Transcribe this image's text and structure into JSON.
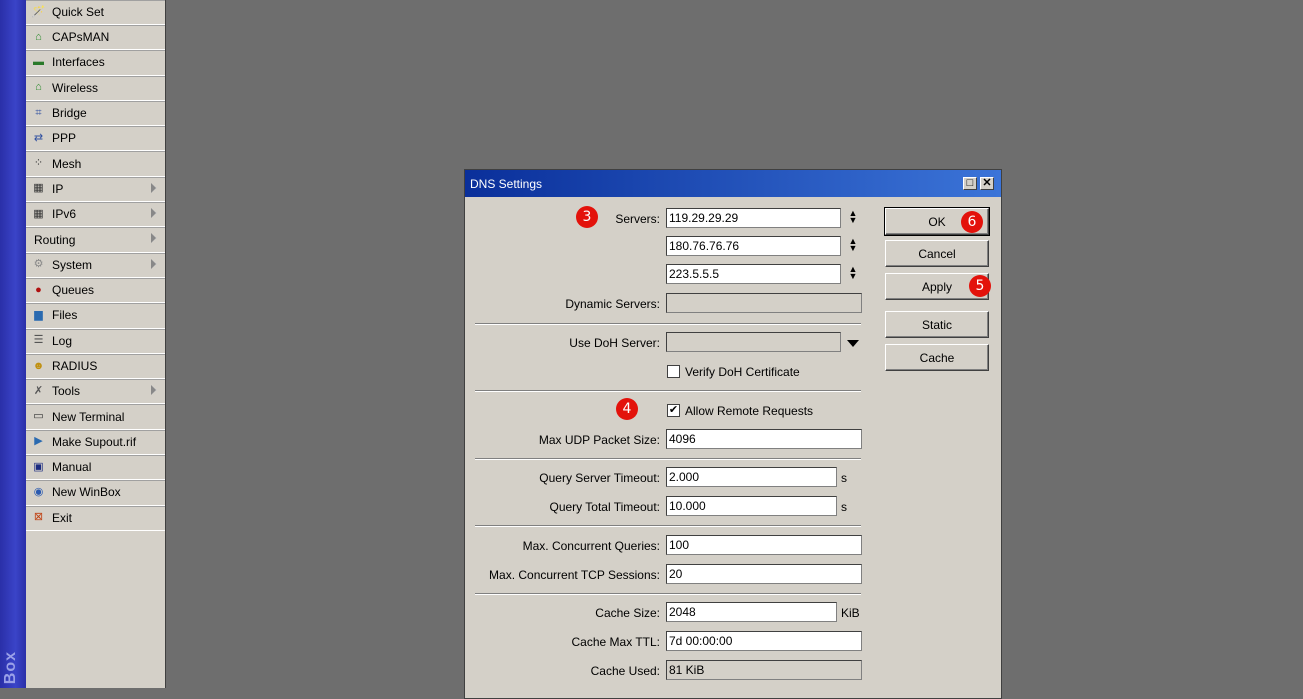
{
  "side_strip": {
    "label": "Box"
  },
  "menu": {
    "items": [
      {
        "label": "Quick Set",
        "icon": "wand-icon",
        "submenu": false
      },
      {
        "label": "CAPsMAN",
        "icon": "antenna-icon",
        "submenu": false
      },
      {
        "label": "Interfaces",
        "icon": "interfaces-icon",
        "submenu": false
      },
      {
        "label": "Wireless",
        "icon": "wireless-icon",
        "submenu": false
      },
      {
        "label": "Bridge",
        "icon": "bridge-icon",
        "submenu": false
      },
      {
        "label": "PPP",
        "icon": "ppp-icon",
        "submenu": false
      },
      {
        "label": "Mesh",
        "icon": "mesh-icon",
        "submenu": false
      },
      {
        "label": "IP",
        "icon": "ip-icon",
        "submenu": true
      },
      {
        "label": "IPv6",
        "icon": "ipv6-icon",
        "submenu": true
      },
      {
        "label": "Routing",
        "icon": "",
        "submenu": true
      },
      {
        "label": "System",
        "icon": "gear-icon",
        "submenu": true
      },
      {
        "label": "Queues",
        "icon": "queues-icon",
        "submenu": false
      },
      {
        "label": "Files",
        "icon": "folder-icon",
        "submenu": false
      },
      {
        "label": "Log",
        "icon": "log-icon",
        "submenu": false
      },
      {
        "label": "RADIUS",
        "icon": "radius-icon",
        "submenu": false
      },
      {
        "label": "Tools",
        "icon": "tools-icon",
        "submenu": true
      },
      {
        "label": "New Terminal",
        "icon": "terminal-icon",
        "submenu": false
      },
      {
        "label": "Make Supout.rif",
        "icon": "supout-icon",
        "submenu": false
      },
      {
        "label": "Manual",
        "icon": "manual-icon",
        "submenu": false
      },
      {
        "label": "New WinBox",
        "icon": "winbox-icon",
        "submenu": false
      },
      {
        "label": "Exit",
        "icon": "exit-icon",
        "submenu": false
      }
    ]
  },
  "dialog": {
    "title": "DNS Settings",
    "servers_label": "Servers:",
    "servers": [
      "119.29.29.29",
      "180.76.76.76",
      "223.5.5.5"
    ],
    "dynamic_servers_label": "Dynamic Servers:",
    "dynamic_servers": "",
    "use_doh_label": "Use DoH Server:",
    "use_doh_value": "",
    "verify_doh_label": "Verify DoH Certificate",
    "verify_doh_checked": false,
    "allow_remote_label": "Allow Remote Requests",
    "allow_remote_checked": true,
    "max_udp_label": "Max UDP Packet Size:",
    "max_udp": "4096",
    "query_server_timeout_label": "Query Server Timeout:",
    "query_server_timeout": "2.000",
    "query_total_timeout_label": "Query Total Timeout:",
    "query_total_timeout": "10.000",
    "seconds_unit": "s",
    "max_concurrent_queries_label": "Max. Concurrent Queries:",
    "max_concurrent_queries": "100",
    "max_concurrent_tcp_label": "Max. Concurrent TCP Sessions:",
    "max_concurrent_tcp": "20",
    "cache_size_label": "Cache Size:",
    "cache_size": "2048",
    "kib_unit": "KiB",
    "cache_max_ttl_label": "Cache Max TTL:",
    "cache_max_ttl": "7d 00:00:00",
    "cache_used_label": "Cache Used:",
    "cache_used": "81 KiB",
    "buttons": {
      "ok": "OK",
      "cancel": "Cancel",
      "apply": "Apply",
      "static": "Static",
      "cache": "Cache"
    }
  },
  "markers": {
    "m3": "3",
    "m4": "4",
    "m5": "5",
    "m6": "6"
  },
  "colors": {
    "titlebar": "#0a2f9a",
    "marker": "#e3120b",
    "desktop": "#6e6e6e",
    "panel": "#d4d0c8"
  }
}
